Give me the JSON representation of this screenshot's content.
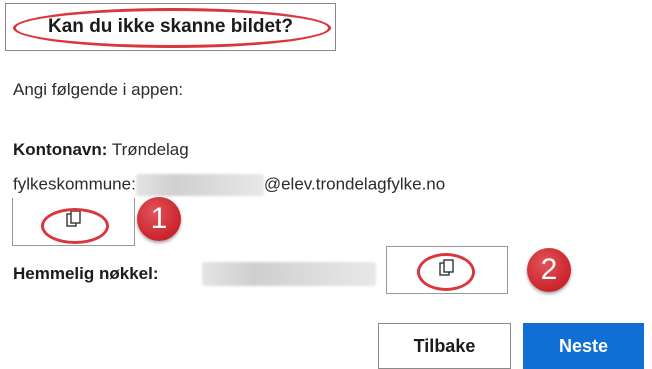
{
  "scan_help": {
    "label": "Kan du ikke skanne bildet?"
  },
  "instruction": "Angi følgende i appen:",
  "account": {
    "label": "Kontonavn:",
    "value_line1": "Trøndelag",
    "value_line2_prefix": "fylkeskommune:",
    "value_line2_suffix": "@elev.trondelagfylke.no"
  },
  "secret": {
    "label": "Hemmelig nøkkel:"
  },
  "markers": {
    "one": "1",
    "two": "2"
  },
  "buttons": {
    "back": "Tilbake",
    "next": "Neste"
  },
  "colors": {
    "annotation": "#d9363e",
    "primary": "#0f6fd3"
  },
  "icons": {
    "copy": "copy-icon"
  }
}
